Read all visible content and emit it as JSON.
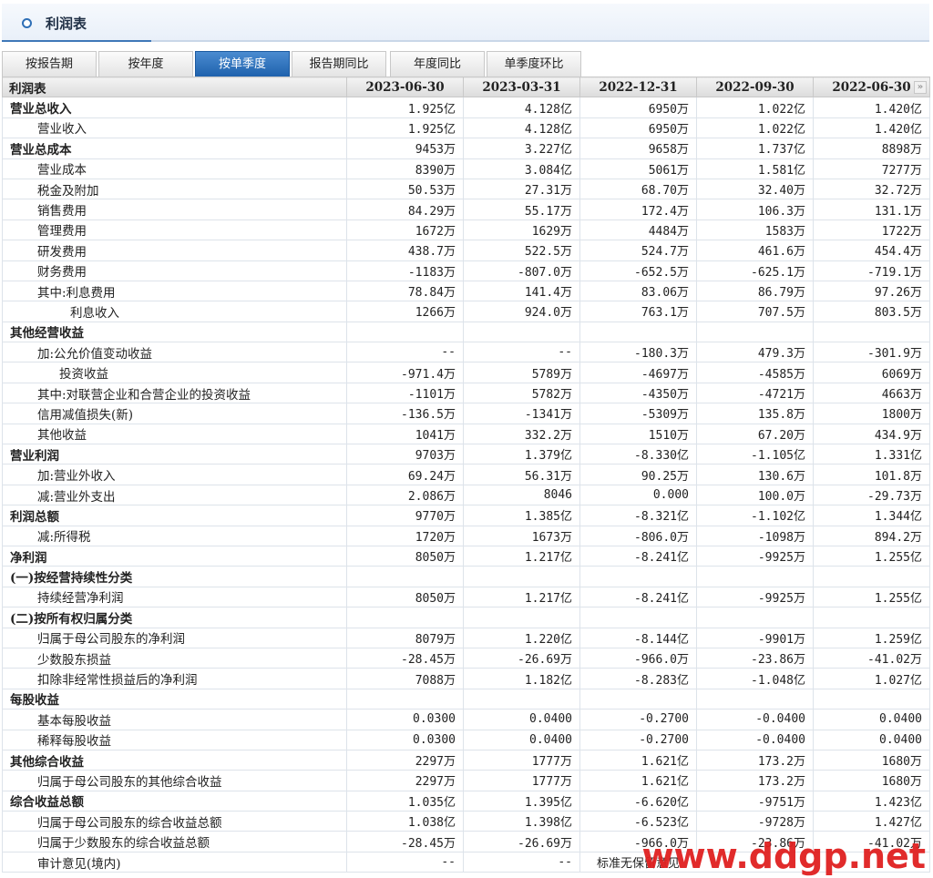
{
  "panel": {
    "title": "利润表"
  },
  "tabs": [
    {
      "label": "按报告期",
      "active": false
    },
    {
      "label": "按年度",
      "active": false
    },
    {
      "label": "按单季度",
      "active": true
    },
    {
      "label": "报告期同比",
      "active": false
    },
    {
      "label": "年度同比",
      "active": false
    },
    {
      "label": "单季度环比",
      "active": false
    }
  ],
  "table": {
    "corner": "利润表",
    "periods": [
      "2023-06-30",
      "2023-03-31",
      "2022-12-31",
      "2022-09-30",
      "2022-06-30"
    ],
    "rows": [
      {
        "label": "营业总收入",
        "style": "bold",
        "values": [
          "1.925亿",
          "4.128亿",
          "6950万",
          "1.022亿",
          "1.420亿"
        ]
      },
      {
        "label": "营业收入",
        "style": "indent1",
        "values": [
          "1.925亿",
          "4.128亿",
          "6950万",
          "1.022亿",
          "1.420亿"
        ]
      },
      {
        "label": "营业总成本",
        "style": "bold",
        "values": [
          "9453万",
          "3.227亿",
          "9658万",
          "1.737亿",
          "8898万"
        ]
      },
      {
        "label": "营业成本",
        "style": "indent1",
        "values": [
          "8390万",
          "3.084亿",
          "5061万",
          "1.581亿",
          "7277万"
        ]
      },
      {
        "label": "税金及附加",
        "style": "indent1",
        "values": [
          "50.53万",
          "27.31万",
          "68.70万",
          "32.40万",
          "32.72万"
        ]
      },
      {
        "label": "销售费用",
        "style": "indent1",
        "values": [
          "84.29万",
          "55.17万",
          "172.4万",
          "106.3万",
          "131.1万"
        ]
      },
      {
        "label": "管理费用",
        "style": "indent1",
        "values": [
          "1672万",
          "1629万",
          "4484万",
          "1583万",
          "1722万"
        ]
      },
      {
        "label": "研发费用",
        "style": "indent1",
        "values": [
          "438.7万",
          "522.5万",
          "524.7万",
          "461.6万",
          "454.4万"
        ]
      },
      {
        "label": "财务费用",
        "style": "indent1",
        "values": [
          "-1183万",
          "-807.0万",
          "-652.5万",
          "-625.1万",
          "-719.1万"
        ]
      },
      {
        "label": "其中:利息费用",
        "style": "indent1",
        "values": [
          "78.84万",
          "141.4万",
          "83.06万",
          "86.79万",
          "97.26万"
        ]
      },
      {
        "label": "利息收入",
        "style": "indent2",
        "values": [
          "1266万",
          "924.0万",
          "763.1万",
          "707.5万",
          "803.5万"
        ]
      },
      {
        "label": "其他经营收益",
        "style": "bold",
        "values": [
          "",
          "",
          "",
          "",
          ""
        ]
      },
      {
        "label": "加:公允价值变动收益",
        "style": "indent1",
        "values": [
          "--",
          "--",
          "-180.3万",
          "479.3万",
          "-301.9万"
        ]
      },
      {
        "label": "投资收益",
        "style": "indent3",
        "values": [
          "-971.4万",
          "5789万",
          "-4697万",
          "-4585万",
          "6069万"
        ]
      },
      {
        "label": "其中:对联营企业和合营企业的投资收益",
        "style": "indent1",
        "values": [
          "-1101万",
          "5782万",
          "-4350万",
          "-4721万",
          "4663万"
        ]
      },
      {
        "label": "信用减值损失(新)",
        "style": "indent1",
        "values": [
          "-136.5万",
          "-1341万",
          "-5309万",
          "135.8万",
          "1800万"
        ]
      },
      {
        "label": "其他收益",
        "style": "indent1",
        "values": [
          "1041万",
          "332.2万",
          "1510万",
          "67.20万",
          "434.9万"
        ]
      },
      {
        "label": "营业利润",
        "style": "bold",
        "values": [
          "9703万",
          "1.379亿",
          "-8.330亿",
          "-1.105亿",
          "1.331亿"
        ]
      },
      {
        "label": "加:营业外收入",
        "style": "indent1",
        "values": [
          "69.24万",
          "56.31万",
          "90.25万",
          "130.6万",
          "101.8万"
        ]
      },
      {
        "label": "减:营业外支出",
        "style": "indent1",
        "values": [
          "2.086万",
          "8046",
          "0.000",
          "100.0万",
          "-29.73万"
        ]
      },
      {
        "label": "利润总额",
        "style": "bold",
        "values": [
          "9770万",
          "1.385亿",
          "-8.321亿",
          "-1.102亿",
          "1.344亿"
        ]
      },
      {
        "label": "减:所得税",
        "style": "indent1",
        "values": [
          "1720万",
          "1673万",
          "-806.0万",
          "-1098万",
          "894.2万"
        ]
      },
      {
        "label": "净利润",
        "style": "bold",
        "values": [
          "8050万",
          "1.217亿",
          "-8.241亿",
          "-9925万",
          "1.255亿"
        ]
      },
      {
        "label": "(一)按经营持续性分类",
        "style": "bold",
        "values": [
          "",
          "",
          "",
          "",
          ""
        ]
      },
      {
        "label": "持续经营净利润",
        "style": "indent1",
        "values": [
          "8050万",
          "1.217亿",
          "-8.241亿",
          "-9925万",
          "1.255亿"
        ]
      },
      {
        "label": "(二)按所有权归属分类",
        "style": "bold",
        "values": [
          "",
          "",
          "",
          "",
          ""
        ]
      },
      {
        "label": "归属于母公司股东的净利润",
        "style": "indent1",
        "values": [
          "8079万",
          "1.220亿",
          "-8.144亿",
          "-9901万",
          "1.259亿"
        ]
      },
      {
        "label": "少数股东损益",
        "style": "indent1",
        "values": [
          "-28.45万",
          "-26.69万",
          "-966.0万",
          "-23.86万",
          "-41.02万"
        ]
      },
      {
        "label": "扣除非经常性损益后的净利润",
        "style": "indent1",
        "values": [
          "7088万",
          "1.182亿",
          "-8.283亿",
          "-1.048亿",
          "1.027亿"
        ]
      },
      {
        "label": "每股收益",
        "style": "bold",
        "values": [
          "",
          "",
          "",
          "",
          ""
        ]
      },
      {
        "label": "基本每股收益",
        "style": "indent1",
        "values": [
          "0.0300",
          "0.0400",
          "-0.2700",
          "-0.0400",
          "0.0400"
        ]
      },
      {
        "label": "稀释每股收益",
        "style": "indent1",
        "values": [
          "0.0300",
          "0.0400",
          "-0.2700",
          "-0.0400",
          "0.0400"
        ]
      },
      {
        "label": "其他综合收益",
        "style": "bold",
        "values": [
          "2297万",
          "1777万",
          "1.621亿",
          "173.2万",
          "1680万"
        ]
      },
      {
        "label": "归属于母公司股东的其他综合收益",
        "style": "indent1",
        "values": [
          "2297万",
          "1777万",
          "1.621亿",
          "173.2万",
          "1680万"
        ]
      },
      {
        "label": "综合收益总额",
        "style": "bold",
        "values": [
          "1.035亿",
          "1.395亿",
          "-6.620亿",
          "-9751万",
          "1.423亿"
        ]
      },
      {
        "label": "归属于母公司股东的综合收益总额",
        "style": "indent1",
        "values": [
          "1.038亿",
          "1.398亿",
          "-6.523亿",
          "-9728万",
          "1.427亿"
        ]
      },
      {
        "label": "归属于少数股东的综合收益总额",
        "style": "indent1",
        "values": [
          "-28.45万",
          "-26.69万",
          "-966.0万",
          "-23.86万",
          "-41.02万"
        ]
      },
      {
        "label": "审计意见(境内)",
        "style": "indent1",
        "values": [
          "--",
          "--",
          "标准无保留意见",
          "",
          ""
        ]
      }
    ]
  },
  "icons": {
    "more": "double-chevron-right-icon",
    "header": "circle-icon"
  },
  "colors": {
    "accent": "#2f6fb6",
    "active_tab": "#1f62ad",
    "watermark": "#e02020"
  },
  "watermark": {
    "text": "www.ddgp.net"
  }
}
